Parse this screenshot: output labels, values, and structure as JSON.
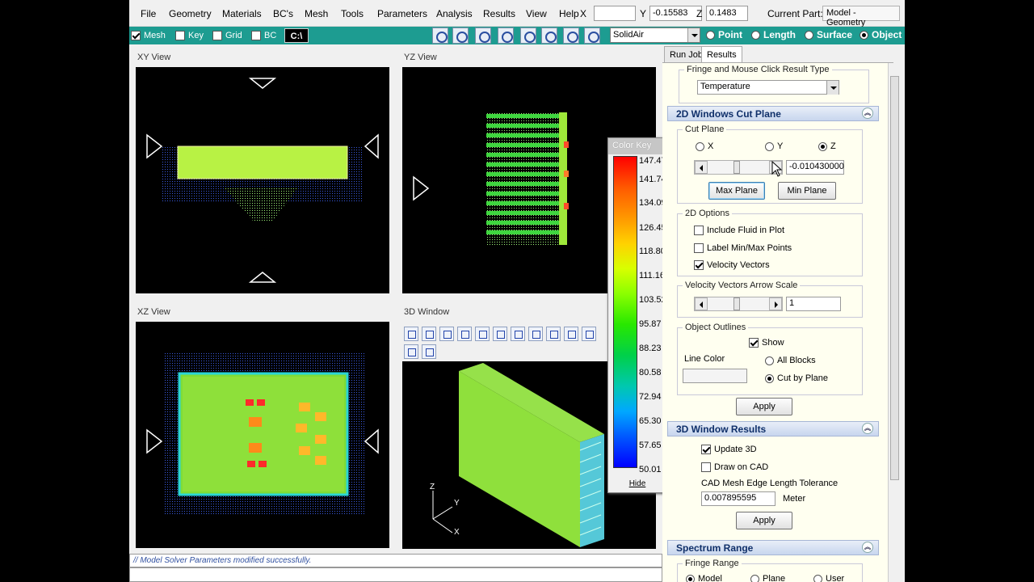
{
  "menu": {
    "items": [
      "File",
      "Geometry",
      "Materials",
      "BC's",
      "Mesh",
      "Tools",
      "Parameters",
      "Analysis",
      "Results",
      "View",
      "Help"
    ],
    "x_label": "X",
    "x_value": "",
    "y_label": "Y",
    "y_value": "-0.15583",
    "z_label": "Z",
    "z_value": "0.1483",
    "current_part_label": "Current Part:",
    "current_part_value": "Model - Geometry"
  },
  "toolbar": {
    "checks": [
      {
        "label": "Mesh",
        "checked": true
      },
      {
        "label": "Key",
        "checked": false
      },
      {
        "label": "Grid",
        "checked": false
      },
      {
        "label": "BC",
        "checked": false
      }
    ],
    "command_button": "C:\\",
    "material_select": "SolidAir",
    "radios": [
      {
        "label": "Point",
        "selected": false
      },
      {
        "label": "Length",
        "selected": false
      },
      {
        "label": "Surface",
        "selected": false
      },
      {
        "label": "Object",
        "selected": true
      }
    ]
  },
  "views": {
    "xy": "XY View",
    "yz": "YZ View",
    "xz": "XZ View",
    "w3d": "3D Window"
  },
  "color_key": {
    "title": "Color Key",
    "labels": [
      "147.47",
      "141.74",
      "134.09",
      "126.45",
      "118.80",
      "111.16",
      "103.52",
      "95.87",
      "88.23",
      "80.58",
      "72.94",
      "65.30",
      "57.65",
      "50.01"
    ],
    "hide": "Hide"
  },
  "panel": {
    "tabs": [
      "Run Job",
      "Results"
    ],
    "active_tab": "Results",
    "fringe_group": "Fringe and Mouse Click Result Type",
    "fringe_value": "Temperature",
    "cut_section": "2D Windows Cut Plane",
    "cut_plane_group": "Cut Plane",
    "axis_x": "X",
    "axis_y": "Y",
    "axis_z": "Z",
    "cut_value": "-0.010430000",
    "max_plane": "Max Plane",
    "min_plane": "Min Plane",
    "options_group": "2D Options",
    "include_fluid": "Include Fluid in Plot",
    "label_minmax": "Label Min/Max Points",
    "velocity_vectors": "Velocity Vectors",
    "arrow_scale_group": "Velocity Vectors Arrow Scale",
    "arrow_scale_value": "1",
    "outlines_group": "Object Outlines",
    "show": "Show",
    "line_color": "Line Color",
    "all_blocks": "All Blocks",
    "cut_by_plane": "Cut by Plane",
    "apply1": "Apply",
    "results_section": "3D Window Results",
    "update_3d": "Update 3D",
    "draw_on_cad": "Draw on CAD",
    "tolerance_label": "CAD Mesh Edge Length Tolerance",
    "tolerance_value": "0.007895595",
    "tolerance_unit": "Meter",
    "apply2": "Apply",
    "spectrum_section": "Spectrum Range",
    "fringe_range_group": "Fringe Range",
    "range_model": "Model",
    "range_plane": "Plane",
    "range_user": "User"
  },
  "status": "// Model Solver Parameters modified successfully."
}
